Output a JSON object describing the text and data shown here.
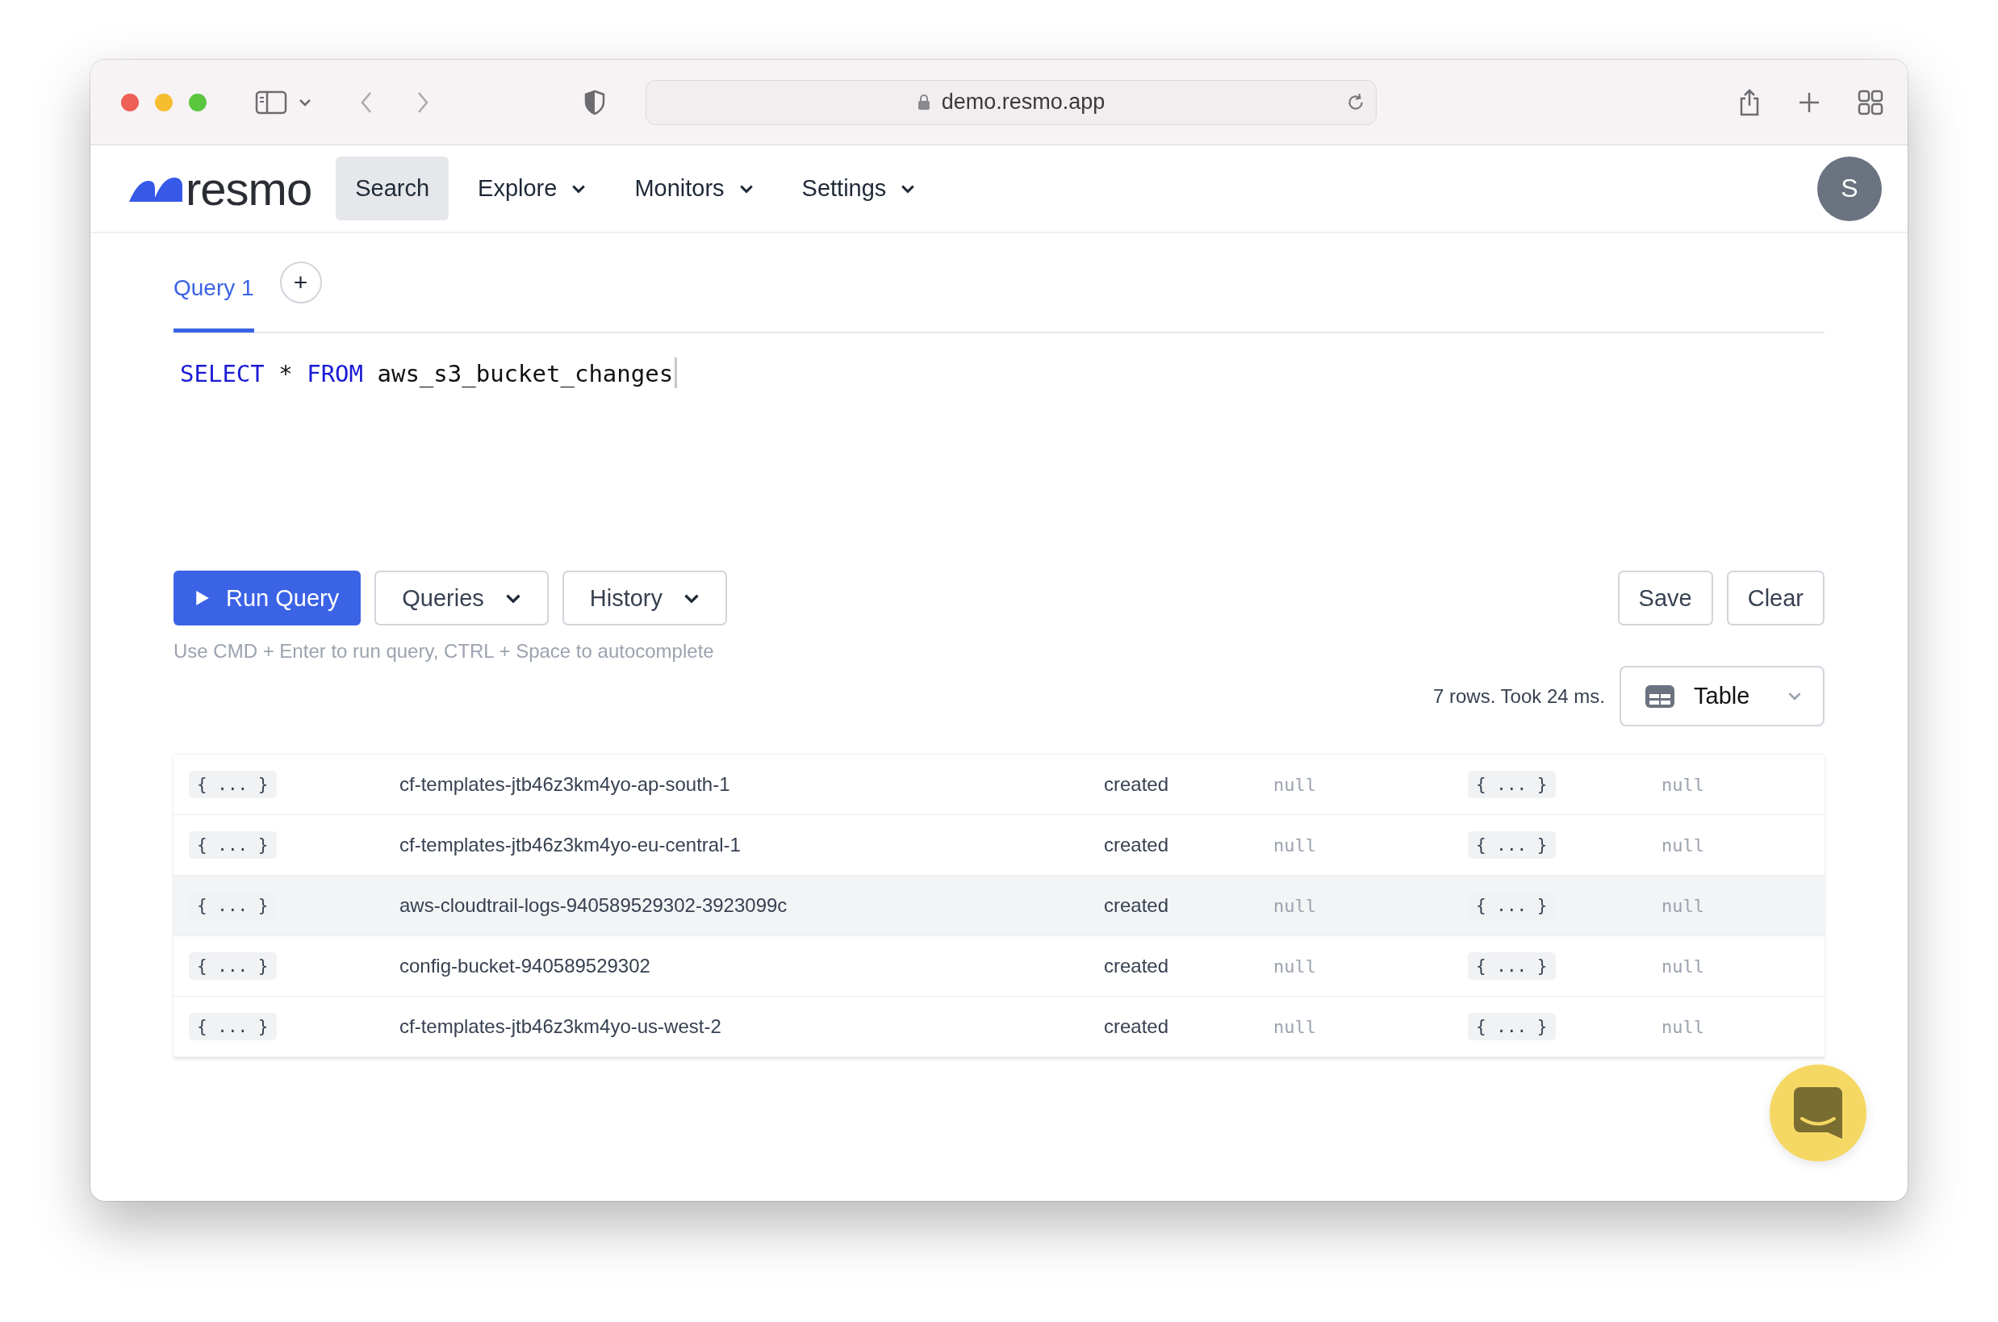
{
  "browser": {
    "url": "demo.resmo.app"
  },
  "nav": {
    "logo": "resmo",
    "items": [
      {
        "label": "Search",
        "selected": true,
        "has_menu": false
      },
      {
        "label": "Explore",
        "selected": false,
        "has_menu": true
      },
      {
        "label": "Monitors",
        "selected": false,
        "has_menu": true
      },
      {
        "label": "Settings",
        "selected": false,
        "has_menu": true
      }
    ],
    "avatar": "S"
  },
  "tabs": [
    {
      "label": "Query 1",
      "selected": true
    }
  ],
  "add_tab": "+",
  "editor": {
    "tokens": [
      {
        "text": "SELECT",
        "kind": "keyword"
      },
      {
        "text": "*",
        "kind": "operator"
      },
      {
        "text": "FROM",
        "kind": "keyword"
      },
      {
        "text": "aws_s3_bucket_changes",
        "kind": "identifier"
      }
    ]
  },
  "toolbar": {
    "run_button": "Run Query",
    "menus": [
      "Queries",
      "History"
    ],
    "actions": [
      "Save",
      "Clear"
    ]
  },
  "hint": "Use CMD + Enter to run query, CTRL + Space to autocomplete",
  "result_summary": "7 rows. Took 24 ms.",
  "view_select": "Table",
  "table": {
    "rows": [
      {
        "highlighted": false,
        "cells": [
          {
            "text": "{ ... }",
            "kind": "object"
          },
          {
            "text": "cf-templates-jtb46z3km4yo-ap-south-1",
            "kind": "text"
          },
          {
            "text": "created",
            "kind": "text"
          },
          {
            "text": "null",
            "kind": "null"
          },
          {
            "text": "{ ... }",
            "kind": "object"
          },
          {
            "text": "null",
            "kind": "null"
          }
        ]
      },
      {
        "highlighted": false,
        "cells": [
          {
            "text": "{ ... }",
            "kind": "object"
          },
          {
            "text": "cf-templates-jtb46z3km4yo-eu-central-1",
            "kind": "text"
          },
          {
            "text": "created",
            "kind": "text"
          },
          {
            "text": "null",
            "kind": "null"
          },
          {
            "text": "{ ... }",
            "kind": "object"
          },
          {
            "text": "null",
            "kind": "null"
          }
        ]
      },
      {
        "highlighted": true,
        "cells": [
          {
            "text": "{ ... }",
            "kind": "object"
          },
          {
            "text": "aws-cloudtrail-logs-940589529302-3923099c",
            "kind": "text"
          },
          {
            "text": "created",
            "kind": "text"
          },
          {
            "text": "null",
            "kind": "null"
          },
          {
            "text": "{ ... }",
            "kind": "object"
          },
          {
            "text": "null",
            "kind": "null"
          }
        ]
      },
      {
        "highlighted": false,
        "cells": [
          {
            "text": "{ ... }",
            "kind": "object"
          },
          {
            "text": "config-bucket-940589529302",
            "kind": "text"
          },
          {
            "text": "created",
            "kind": "text"
          },
          {
            "text": "null",
            "kind": "null"
          },
          {
            "text": "{ ... }",
            "kind": "object"
          },
          {
            "text": "null",
            "kind": "null"
          }
        ]
      },
      {
        "highlighted": false,
        "cells": [
          {
            "text": "{ ... }",
            "kind": "object"
          },
          {
            "text": "cf-templates-jtb46z3km4yo-us-west-2",
            "kind": "text"
          },
          {
            "text": "created",
            "kind": "text"
          },
          {
            "text": "null",
            "kind": "null"
          },
          {
            "text": "{ ... }",
            "kind": "object"
          },
          {
            "text": "null",
            "kind": "null"
          }
        ]
      }
    ]
  }
}
